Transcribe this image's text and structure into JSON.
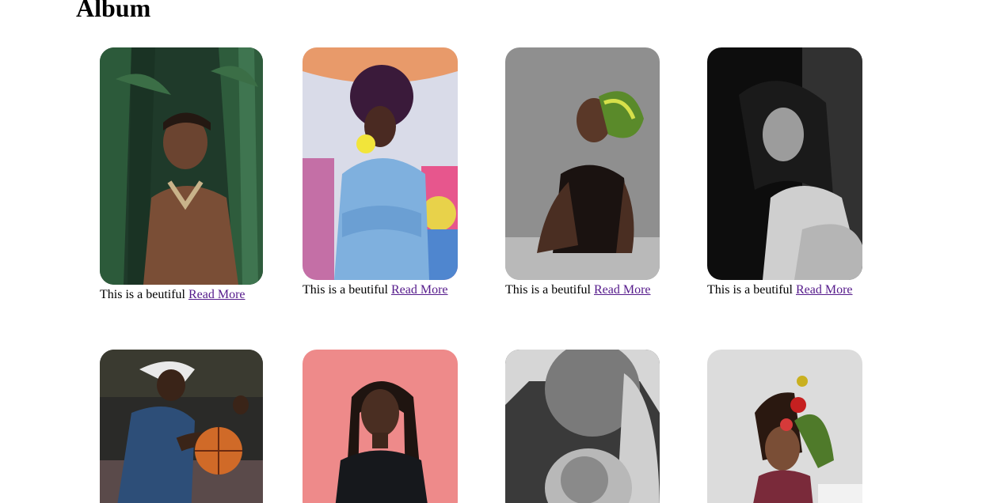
{
  "page": {
    "heading": "Album"
  },
  "album": {
    "items": [
      {
        "caption": "This is a beutiful",
        "link_label": "Read More",
        "photo": "man-in-jungle-photo"
      },
      {
        "caption": "This is a beutiful",
        "link_label": "Read More",
        "photo": "woman-denim-jacket-photo"
      },
      {
        "caption": "This is a beutiful",
        "link_label": "Read More",
        "photo": "woman-headwrap-photo"
      },
      {
        "caption": "This is a beutiful",
        "link_label": "Read More",
        "photo": "woman-smiling-bw-photo"
      },
      {
        "photo": "basketball-player-photo"
      },
      {
        "photo": "woman-pink-background-photo"
      },
      {
        "photo": "grandmother-baby-bw-photo"
      },
      {
        "photo": "woman-flower-crown-photo"
      }
    ]
  }
}
